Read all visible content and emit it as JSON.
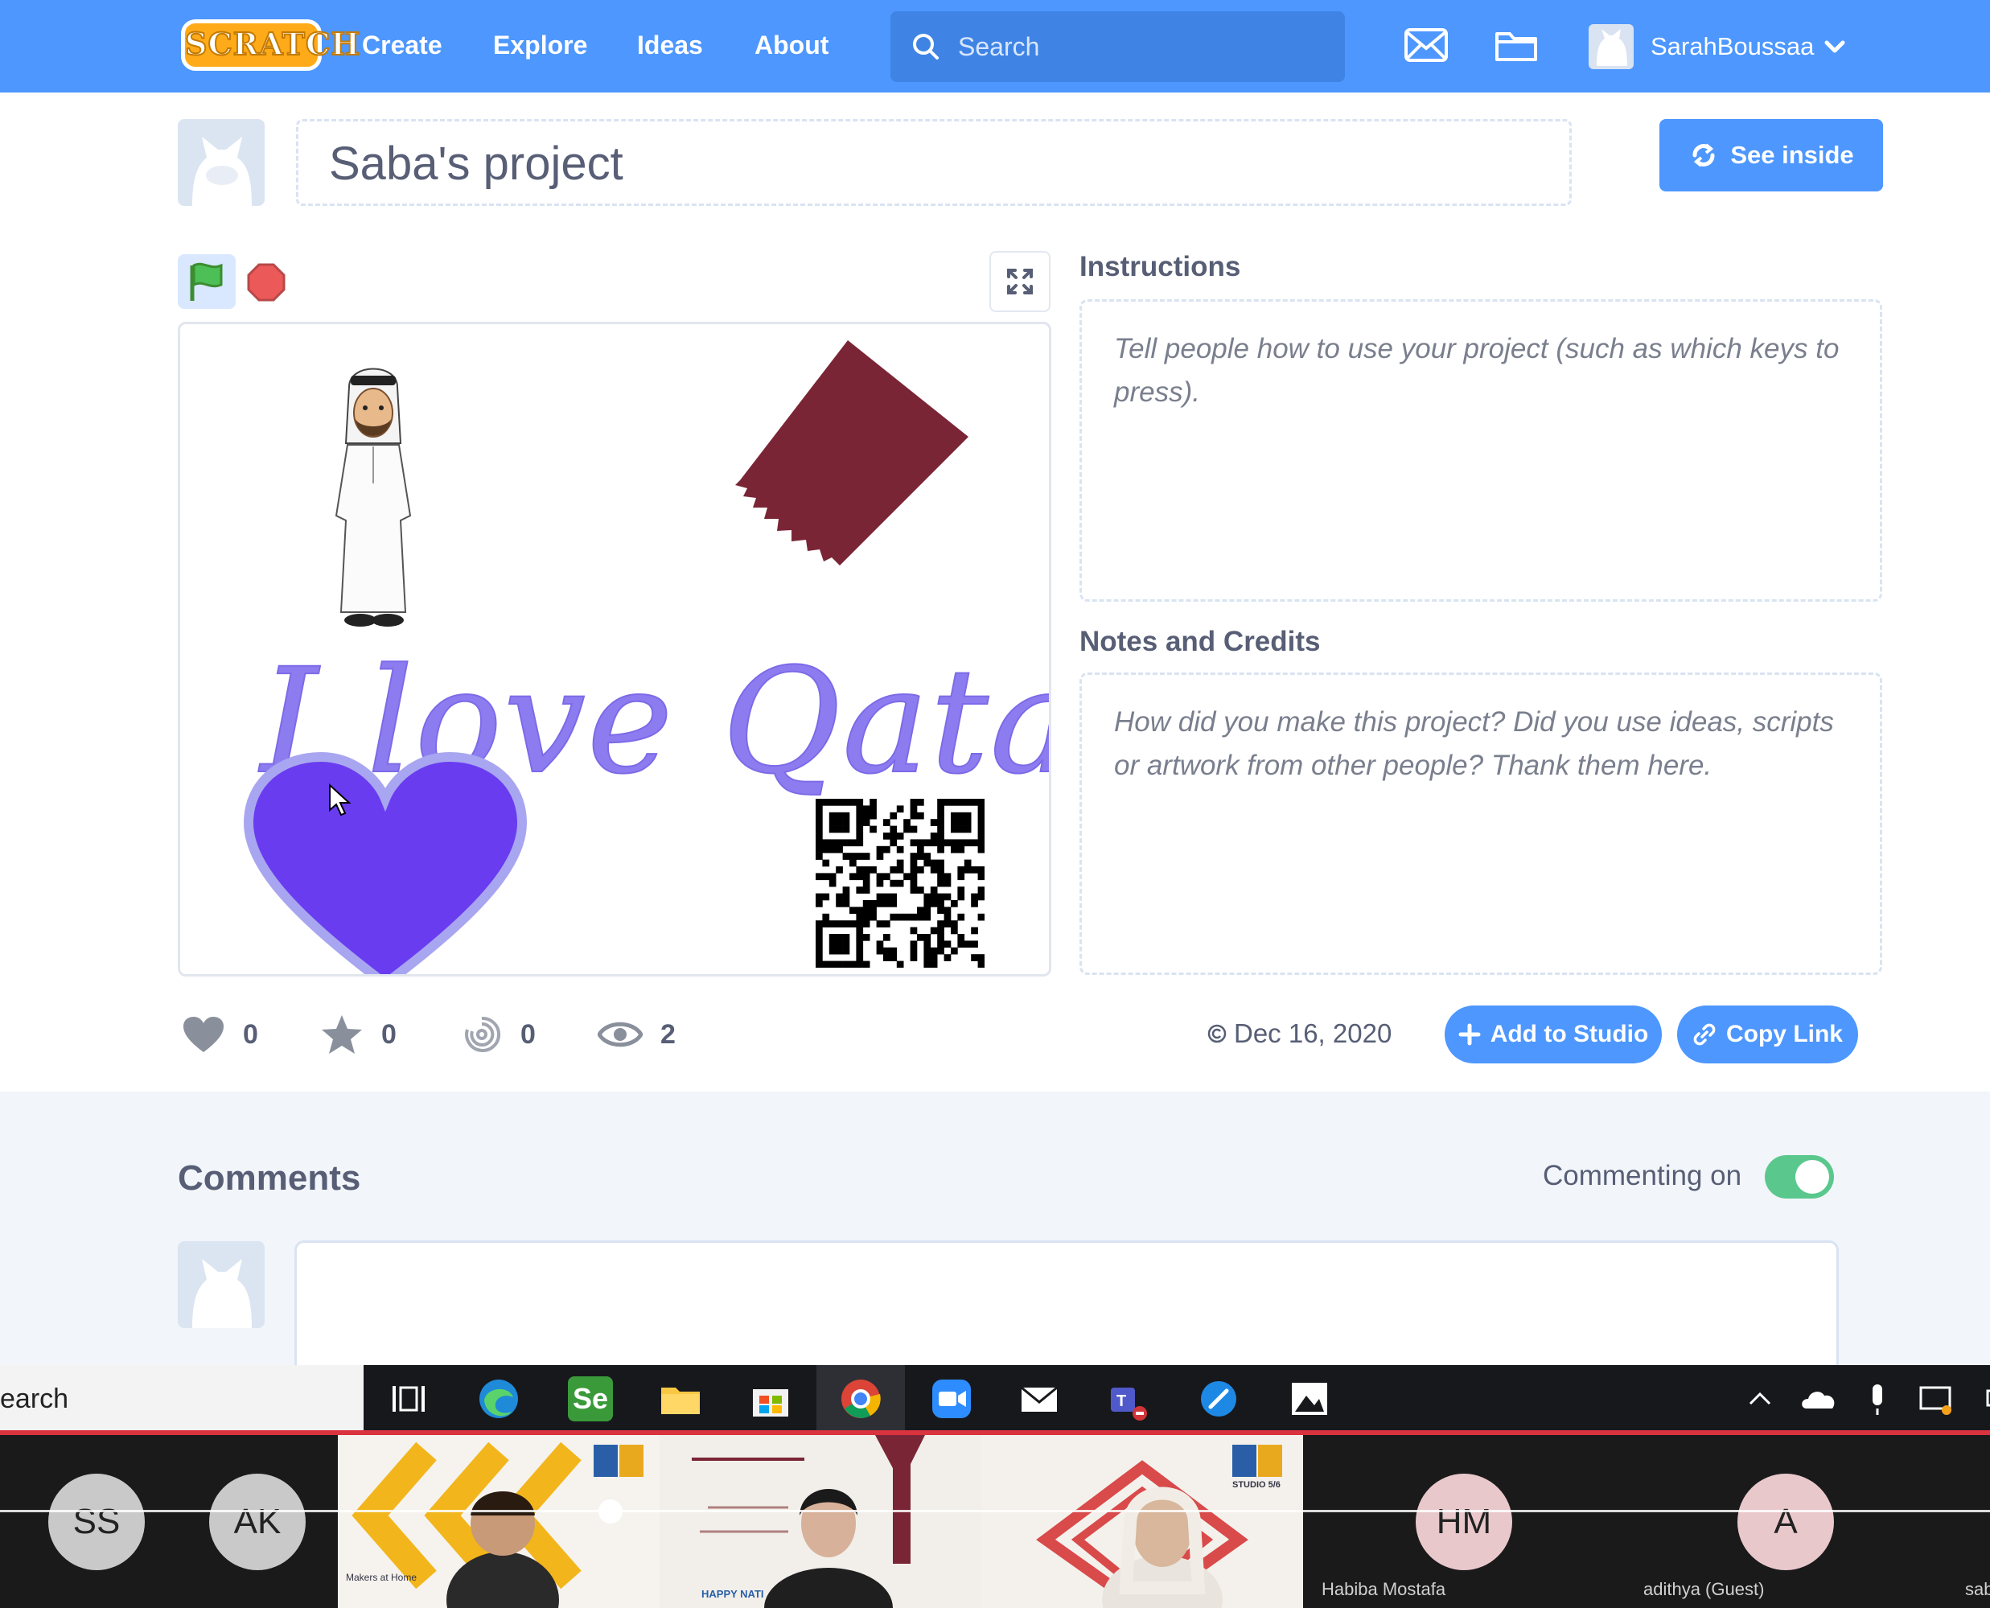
{
  "nav": {
    "logo": "SCRATCH",
    "links": [
      "Create",
      "Explore",
      "Ideas",
      "About"
    ],
    "search_placeholder": "Search",
    "username": "SarahBoussaa"
  },
  "project": {
    "title": "Saba's project",
    "see_inside": "See inside",
    "stage_text": "I love Qatar"
  },
  "instructions": {
    "heading": "Instructions",
    "placeholder": "Tell people how to use your project (such as which keys to press)."
  },
  "notes": {
    "heading": "Notes and Credits",
    "placeholder": "How did you make this project? Did you use ideas, scripts or artwork from other people? Thank them here."
  },
  "stats": {
    "loves": "0",
    "favorites": "0",
    "remixes": "0",
    "views": "2",
    "date": "Dec 16, 2020"
  },
  "actions": {
    "add_to_studio": "Add to Studio",
    "copy_link": "Copy Link"
  },
  "comments": {
    "heading": "Comments",
    "commenting_label": "Commenting on",
    "commenting_enabled": true
  },
  "taskbar": {
    "search_text": "earch"
  },
  "meeting": {
    "participants": [
      {
        "initials": "SS",
        "color": "#c9c9c9"
      },
      {
        "initials": "AK",
        "color": "#c9c9c9"
      },
      {
        "initials": "HM",
        "color": "#e9c8cc",
        "name": "Habiba Mostafa"
      },
      {
        "initials": "A",
        "color": "#e9c8cc",
        "name": "adithya (Guest)"
      }
    ],
    "last_name_fragment": "sab",
    "banner_text": "Makers at Home",
    "studio_text": "STUDIO 5/6",
    "happy_text": "HAPPY NATI"
  },
  "colors": {
    "brand_blue": "#4d97ff",
    "flag_maroon": "#7a2535",
    "heart_purple": "#6a3cf0",
    "toggle_green": "#5ac88d"
  }
}
